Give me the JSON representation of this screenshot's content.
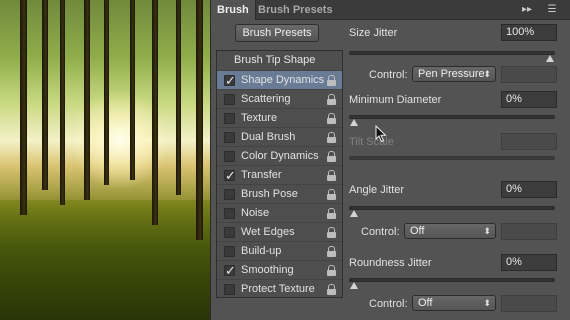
{
  "tabs": [
    {
      "label": "Brush",
      "active": true
    },
    {
      "label": "Brush Presets",
      "active": false
    }
  ],
  "header_icons": {
    "collapse": "double-chevron-right-icon",
    "menu": "panel-menu-icon",
    "collapse_glyph": "▸▸",
    "menu_glyph": "☰"
  },
  "brush_presets_button": "Brush Presets",
  "options_header": "Brush Tip Shape",
  "options": [
    {
      "label": "Shape Dynamics",
      "checked": true,
      "selected": true
    },
    {
      "label": "Scattering",
      "checked": false
    },
    {
      "label": "Texture",
      "checked": false
    },
    {
      "label": "Dual Brush",
      "checked": false
    },
    {
      "label": "Color Dynamics",
      "checked": false
    },
    {
      "label": "Transfer",
      "checked": true
    },
    {
      "label": "Brush Pose",
      "checked": false
    },
    {
      "label": "Noise",
      "checked": false
    },
    {
      "label": "Wet Edges",
      "checked": false
    },
    {
      "label": "Build-up",
      "checked": false
    },
    {
      "label": "Smoothing",
      "checked": true
    },
    {
      "label": "Protect Texture",
      "checked": false
    }
  ],
  "check_glyph": "✓",
  "settings": {
    "size_jitter": {
      "label": "Size Jitter",
      "value": "100%",
      "level": 1.0
    },
    "size_control": {
      "label": "Control:",
      "value": "Pen Pressure"
    },
    "minimum_diameter": {
      "label": "Minimum Diameter",
      "value": "0%",
      "level": 0.0
    },
    "tilt_scale": {
      "label": "Tilt Scale",
      "value": "",
      "level": 0.0,
      "disabled": true
    },
    "angle_jitter": {
      "label": "Angle Jitter",
      "value": "0%",
      "level": 0.0
    },
    "angle_control": {
      "label": "Control:",
      "value": "Off"
    },
    "roundness_jitter": {
      "label": "Roundness Jitter",
      "value": "0%",
      "level": 0.0
    },
    "roundness_control": {
      "label": "Control:",
      "value": "Off"
    }
  },
  "select_arrow": "⬍",
  "colors": {
    "panel_bg": "#535353",
    "selection": "#6a7b96",
    "tab_bar": "#3b3b3b"
  }
}
